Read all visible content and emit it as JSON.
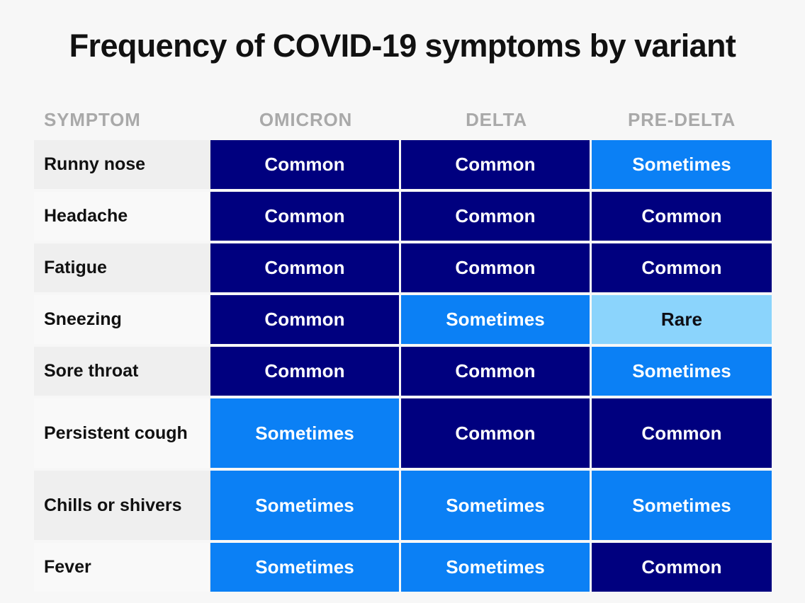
{
  "page": {
    "title": "Frequency of COVID-19 symptoms by variant",
    "background_color": "#f7f7f7"
  },
  "table": {
    "columns": [
      {
        "key": "symptom",
        "label": "SYMPTOM"
      },
      {
        "key": "omicron",
        "label": "OMICRON"
      },
      {
        "key": "delta",
        "label": "DELTA"
      },
      {
        "key": "pre_delta",
        "label": "PRE-DELTA"
      }
    ],
    "legend_levels": [
      {
        "value": "Common",
        "fill": "#00007f",
        "text_color": "#ffffff"
      },
      {
        "value": "Sometimes",
        "fill": "#0b80f5",
        "text_color": "#ffffff"
      },
      {
        "value": "Rare",
        "fill": "#8bd4fc",
        "text_color": "#0d0d14"
      }
    ],
    "rows": [
      {
        "symptom": "Runny nose",
        "omicron": "Common",
        "delta": "Common",
        "pre_delta": "Sometimes"
      },
      {
        "symptom": "Headache",
        "omicron": "Common",
        "delta": "Common",
        "pre_delta": "Common"
      },
      {
        "symptom": "Fatigue",
        "omicron": "Common",
        "delta": "Common",
        "pre_delta": "Common"
      },
      {
        "symptom": "Sneezing",
        "omicron": "Common",
        "delta": "Sometimes",
        "pre_delta": "Rare"
      },
      {
        "symptom": "Sore throat",
        "omicron": "Common",
        "delta": "Common",
        "pre_delta": "Sometimes"
      },
      {
        "symptom": "Persistent cough",
        "omicron": "Sometimes",
        "delta": "Common",
        "pre_delta": "Common"
      },
      {
        "symptom": "Chills or shivers",
        "omicron": "Sometimes",
        "delta": "Sometimes",
        "pre_delta": "Sometimes"
      },
      {
        "symptom": "Fever",
        "omicron": "Sometimes",
        "delta": "Sometimes",
        "pre_delta": "Common"
      }
    ]
  },
  "chart_data": {
    "type": "heatmap",
    "title": "Frequency of COVID-19 symptoms by variant",
    "xlabel": "",
    "ylabel": "SYMPTOM",
    "categories": [
      "OMICRON",
      "DELTA",
      "PRE-DELTA"
    ],
    "rows": [
      "Runny nose",
      "Headache",
      "Fatigue",
      "Sneezing",
      "Sore throat",
      "Persistent cough",
      "Chills or shivers",
      "Fever"
    ],
    "value_scale": [
      "Rare",
      "Sometimes",
      "Common"
    ],
    "values": [
      [
        "Common",
        "Common",
        "Sometimes"
      ],
      [
        "Common",
        "Common",
        "Common"
      ],
      [
        "Common",
        "Common",
        "Common"
      ],
      [
        "Common",
        "Sometimes",
        "Rare"
      ],
      [
        "Common",
        "Common",
        "Sometimes"
      ],
      [
        "Sometimes",
        "Common",
        "Common"
      ],
      [
        "Sometimes",
        "Sometimes",
        "Sometimes"
      ],
      [
        "Sometimes",
        "Sometimes",
        "Common"
      ]
    ],
    "colors": {
      "Common": "#00007f",
      "Sometimes": "#0b80f5",
      "Rare": "#8bd4fc"
    },
    "legend_position": "none",
    "grid": false
  }
}
